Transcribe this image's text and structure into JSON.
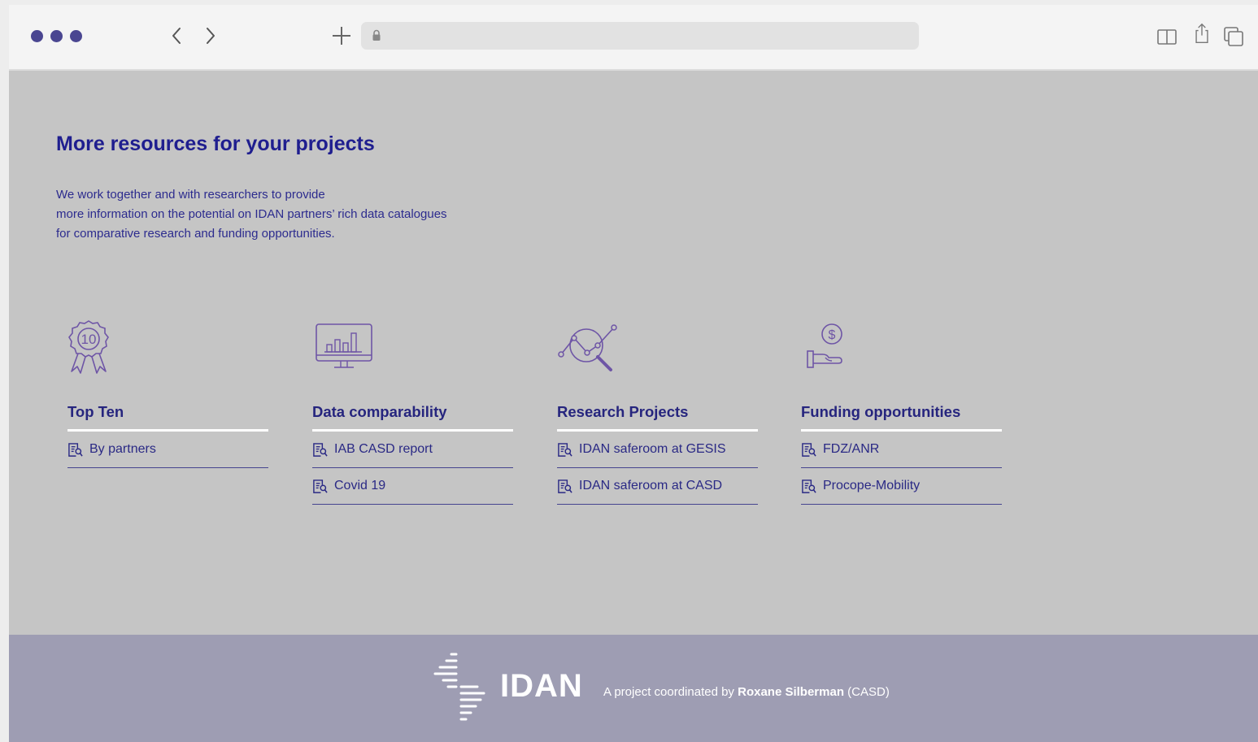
{
  "browser": {
    "url": "",
    "icons": [
      "menu-dots-icon",
      "back-chevron-icon",
      "forward-chevron-icon",
      "new-tab-plus-icon",
      "lock-icon",
      "reader-book-icon",
      "share-icon",
      "tabs-overview-icon"
    ]
  },
  "section": {
    "title": "More resources for your projects",
    "intro": [
      "We work together and with researchers to provide",
      "more information on the potential on IDAN partners’ rich data catalogues",
      "for comparative research and funding opportunities."
    ]
  },
  "columns": [
    {
      "icon": "award-ribbon-10-icon",
      "icon_label": "10",
      "title": "Top Ten",
      "links": [
        {
          "label": "By partners",
          "icon": "document-search-icon"
        }
      ]
    },
    {
      "icon": "monitor-bar-chart-icon",
      "title": "Data comparability",
      "links": [
        {
          "label": "IAB CASD report",
          "icon": "document-search-icon"
        },
        {
          "label": "Covid 19",
          "icon": "document-search-icon"
        }
      ]
    },
    {
      "icon": "magnifier-line-chart-icon",
      "title": "Research Projects",
      "links": [
        {
          "label": "IDAN saferoom at GESIS",
          "icon": "document-search-icon"
        },
        {
          "label": "IDAN saferoom at CASD",
          "icon": "document-search-icon"
        }
      ]
    },
    {
      "icon": "hand-coin-dollar-icon",
      "icon_label": "$",
      "title": "Funding opportunities",
      "links": [
        {
          "label": "FDZ/ANR",
          "icon": "document-search-icon"
        },
        {
          "label": "Procope-Mobility",
          "icon": "document-search-icon"
        }
      ]
    }
  ],
  "footer": {
    "logo_text": "IDAN",
    "credit_prefix": "A project coordinated by ",
    "credit_name": "Roxane Silberman",
    "credit_suffix": " (CASD)"
  },
  "colors": {
    "heading": "#1f1e8f",
    "content_bg": "#c5c5c5",
    "footer_bg": "#9e9db3",
    "accent_line": "#ffffff",
    "window_dots": "#4a4691"
  }
}
